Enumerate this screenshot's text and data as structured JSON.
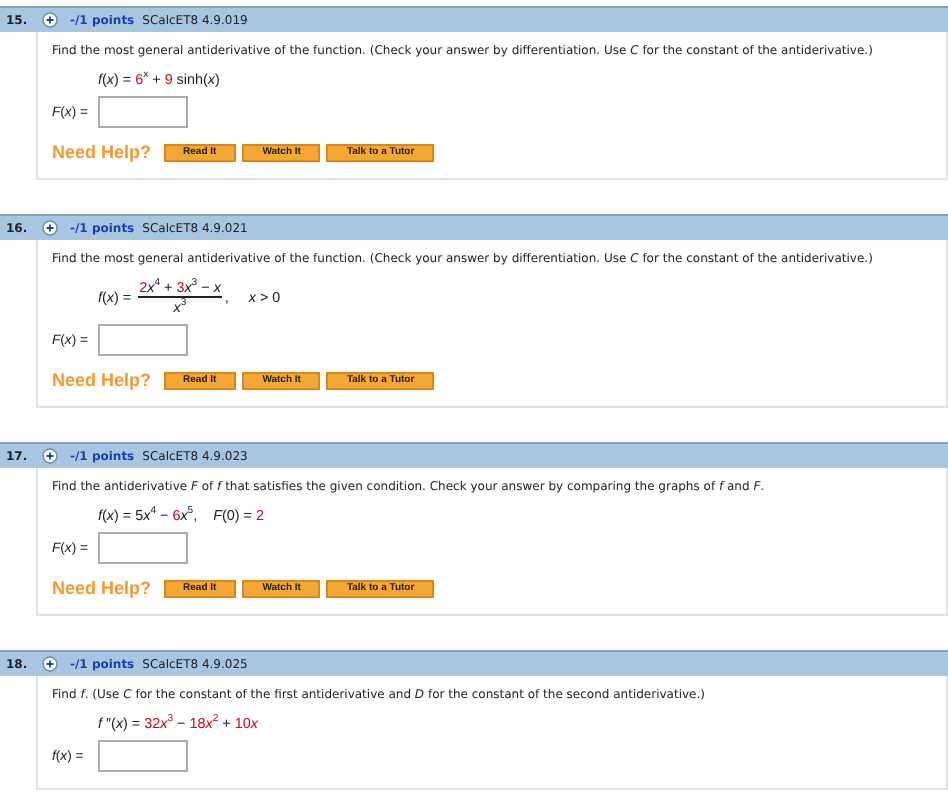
{
  "questions": [
    {
      "number": "15.",
      "points": "-/1 points",
      "source": "SCalcET8 4.9.019",
      "prompt": "Find the most general antiderivative of the function. (Check your answer by differentiation. Use *C* for the constant of the antiderivative.)",
      "formula": [
        {
          "kind": "text",
          "text": "*f*(*x*) = ",
          "red": false
        },
        {
          "kind": "text",
          "text": "6",
          "red": true
        },
        {
          "kind": "text",
          "text": "$^{x}$ + ",
          "red": false
        },
        {
          "kind": "text",
          "text": "9",
          "red": true
        },
        {
          "kind": "text",
          "text": " sinh(*x*)",
          "red": false
        }
      ],
      "answer_label": "*F*(*x*) =",
      "help": {
        "label": "Need Help?",
        "buttons": [
          "Read It",
          "Watch It",
          "Talk to a Tutor"
        ]
      }
    },
    {
      "number": "16.",
      "points": "-/1 points",
      "source": "SCalcET8 4.9.021",
      "prompt": "Find the most general antiderivative of the function. (Check your answer by differentiation. Use *C* for the constant of the antiderivative.)",
      "formula": [
        {
          "kind": "text",
          "text": "*f*(*x*) = ",
          "red": false
        },
        {
          "kind": "fraction",
          "numerator": [
            {
              "text": "2",
              "red": true
            },
            {
              "text": "*x*$^{4}$ + ",
              "red": false
            },
            {
              "text": "3",
              "red": true
            },
            {
              "text": "*x*$^{3}$ − *x*",
              "red": false
            }
          ],
          "denominator": [
            {
              "text": "*x*$^{3}$",
              "red": false
            }
          ]
        },
        {
          "kind": "text",
          "text": ",     *x* > 0",
          "red": false
        }
      ],
      "answer_label": "*F*(*x*) =",
      "help": {
        "label": "Need Help?",
        "buttons": [
          "Read It",
          "Watch It",
          "Talk to a Tutor"
        ]
      }
    },
    {
      "number": "17.",
      "points": "-/1 points",
      "source": "SCalcET8 4.9.023",
      "prompt": "Find the antiderivative *F* of *f* that satisfies the given condition. Check your answer by comparing the graphs of *f* and *F*.",
      "formula": [
        {
          "kind": "text",
          "text": "*f*(*x*) = 5",
          "red": false
        },
        {
          "kind": "text",
          "text": "*x*$^{4}$ − ",
          "red": false
        },
        {
          "kind": "text",
          "text": "6",
          "red": true
        },
        {
          "kind": "text",
          "text": "*x*$^{5}$,    *F*(0) = ",
          "red": false
        },
        {
          "kind": "text",
          "text": "2",
          "red": true
        }
      ],
      "answer_label": "*F*(*x*) =",
      "help": {
        "label": "Need Help?",
        "buttons": [
          "Read It",
          "Watch It",
          "Talk to a Tutor"
        ]
      }
    },
    {
      "number": "18.",
      "points": "-/1 points",
      "source": "SCalcET8 4.9.025",
      "prompt": "Find *f*. (Use *C* for the constant of the first antiderivative and *D* for the constant of the second antiderivative.)",
      "formula": [
        {
          "kind": "text",
          "text": "*f* ″(*x*) = ",
          "red": false
        },
        {
          "kind": "text",
          "text": "32",
          "red": true
        },
        {
          "kind": "text",
          "text": "*x*$^{3}$",
          "red": true
        },
        {
          "kind": "text",
          "text": " − ",
          "red": false
        },
        {
          "kind": "text",
          "text": "18",
          "red": true
        },
        {
          "kind": "text",
          "text": "*x*$^{2}$",
          "red": true
        },
        {
          "kind": "text",
          "text": " + ",
          "red": false
        },
        {
          "kind": "text",
          "text": "10",
          "red": true
        },
        {
          "kind": "text",
          "text": "*x*",
          "red": true
        }
      ],
      "answer_label": "*f*(*x*) ="
    }
  ]
}
